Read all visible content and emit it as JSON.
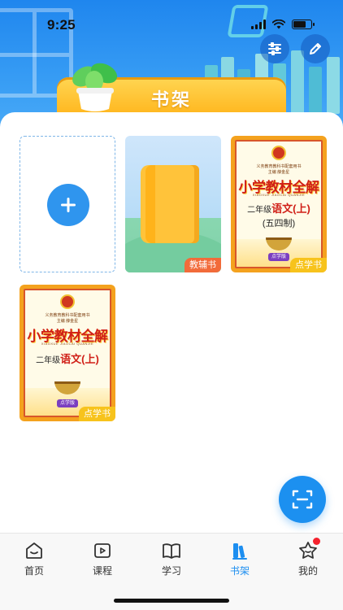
{
  "status_bar": {
    "time": "9:25"
  },
  "header": {
    "title": "书架",
    "settings_icon": "sliders-icon",
    "edit_icon": "pencil-icon"
  },
  "shelf": {
    "add_icon": "plus-icon",
    "books": [
      {
        "type": "tutor",
        "tag": "教辅书",
        "tag_color": "#f26b3a"
      },
      {
        "type": "textbook",
        "tag": "点学书",
        "tag_color": "#f7c31c",
        "cover": {
          "top_line": "义务教育教科书配套用书",
          "title": "小学教材全解",
          "pinyin": "XIAOXUE JIAOCAI QUANJIE",
          "grade": "二年级",
          "subject": "语文",
          "volume": "(上)",
          "edition": "(五四制)",
          "editor": "主编 薛金星",
          "badge": "点学版"
        }
      },
      {
        "type": "textbook",
        "tag": "点学书",
        "tag_color": "#f7c31c",
        "cover": {
          "top_line": "义务教育教科书配套用书",
          "title": "小学教材全解",
          "pinyin": "XIAOXUE JIAOCAI QUANJIE",
          "grade": "二年级",
          "subject": "语文",
          "volume": "(上)",
          "editor": "主编 薛金星",
          "badge": "点学版"
        }
      }
    ]
  },
  "scan_icon": "scan-icon",
  "tabbar": {
    "items": [
      {
        "label": "首页",
        "icon": "home-icon"
      },
      {
        "label": "课程",
        "icon": "play-icon"
      },
      {
        "label": "学习",
        "icon": "open-book-icon"
      },
      {
        "label": "书架",
        "icon": "bookshelf-icon",
        "active": true
      },
      {
        "label": "我的",
        "icon": "star-profile-icon",
        "badge_dot": true
      }
    ]
  },
  "colors": {
    "accent": "#1c8ef0",
    "banner": "#ffc327",
    "tag_orange": "#f26b3a",
    "tag_yellow": "#f7c31c"
  }
}
